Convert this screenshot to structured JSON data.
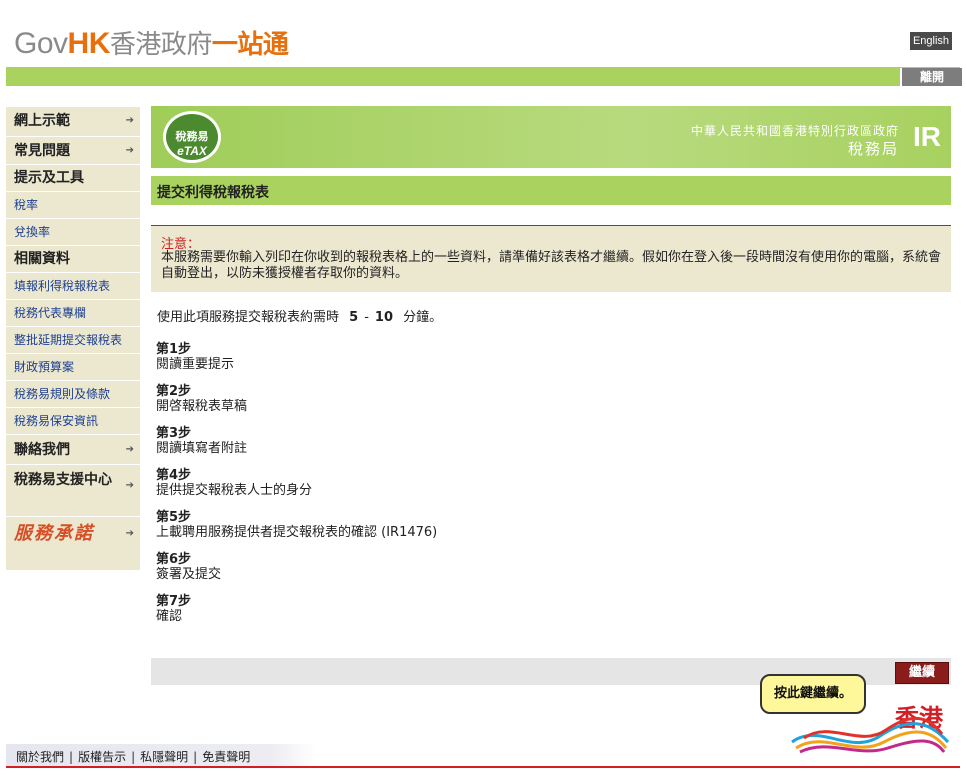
{
  "header": {
    "logo_gov": "Gov",
    "logo_hk": "HK",
    "logo_zh_grey": "香港政府",
    "logo_zh_orange": "一站通",
    "lang_button": "English",
    "exit_button": "離開"
  },
  "sidebar": {
    "demo": "網上示範",
    "faq": "常見問題",
    "tips_heading": "提示及工具",
    "tax_rate": "稅率",
    "exchange_rate": "兌換率",
    "related_heading": "相關資料",
    "fill_return": "填報利得稅報稅表",
    "tax_rep": "稅務代表專欄",
    "bulk_ext": "整批延期提交報稅表",
    "budget": "財政預算案",
    "etax_rules": "稅務易規則及條款",
    "etax_security": "稅務易保安資訊",
    "contact": "聯絡我們",
    "support_center": "稅務易支援中心",
    "pledge": "服務承諾"
  },
  "banner": {
    "etax_zh": "稅務易",
    "etax_en": "eTAX",
    "gov_name": "中華人民共和國香港特別行政區政府",
    "dept_name": "稅務局",
    "dept_logo": "IR"
  },
  "page_title": "提交利得稅報稅表",
  "notice": {
    "title": "注意：",
    "body": "本服務需要你輸入列印在你收到的報稅表格上的一些資料，請準備好該表格才繼續。假如你在登入後一段時間沒有使用你的電腦，系統會自動登出，以防未獲授權者存取你的資料。"
  },
  "intro": {
    "prefix": "使用此項服務提交報稅表約需時",
    "min": "5",
    "dash": "-",
    "max": "10",
    "suffix": "分鐘。"
  },
  "steps": [
    {
      "label": "第1步",
      "desc": "閱讀重要提示"
    },
    {
      "label": "第2步",
      "desc": "開啓報稅表草稿"
    },
    {
      "label": "第3步",
      "desc": "閱讀填寫者附註"
    },
    {
      "label": "第4步",
      "desc": "提供提交報稅表人士的身分"
    },
    {
      "label": "第5步",
      "desc": "上載聘用服務提供者提交報稅表的確認 (IR1476)"
    },
    {
      "label": "第6步",
      "desc": "簽署及提交"
    },
    {
      "label": "第7步",
      "desc": "確認"
    }
  ],
  "continue_button": "繼續",
  "tooltip": "按此鍵繼續。",
  "brand_hk": "香港",
  "footer": {
    "about": "關於我們",
    "copyright": "版權告示",
    "privacy": "私隱聲明",
    "disclaimer": "免責聲明",
    "separator": "|"
  },
  "colors": {
    "green": "#a9d35e",
    "beige": "#ece8d0",
    "orange": "#e8700c",
    "dark_red": "#8b1c1c",
    "link_blue": "#1d3f8f"
  }
}
